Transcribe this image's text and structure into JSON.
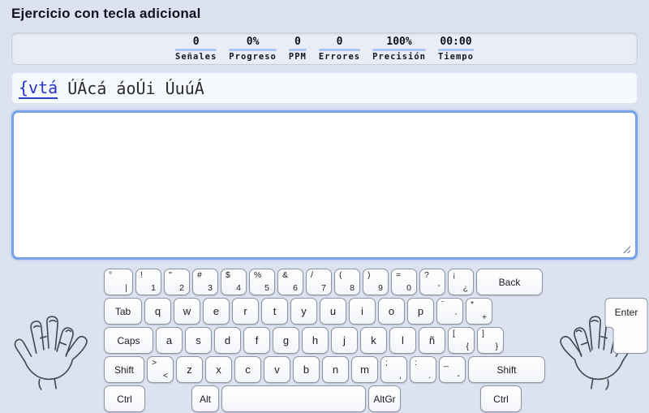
{
  "title": "Ejercicio con tecla adicional",
  "stats": {
    "items": [
      {
        "value": "0",
        "label": "Señales"
      },
      {
        "value": "0%",
        "label": "Progreso"
      },
      {
        "value": "0",
        "label": "PPM"
      },
      {
        "value": "0",
        "label": "Errores"
      },
      {
        "value": "100%",
        "label": "Precisión"
      },
      {
        "value": "00:00",
        "label": "Tiempo"
      }
    ]
  },
  "exercise": {
    "highlight": "{vtá",
    "remaining": " ÚÁcá áoÚi ÚuúÁ"
  },
  "typing_area": {
    "value": "",
    "placeholder": ""
  },
  "keyboard": {
    "enter_label": "Enter",
    "rows": [
      {
        "keys": [
          {
            "shift": "°",
            "main": "|",
            "w": 36
          },
          {
            "shift": "!",
            "main": "1",
            "w": 32
          },
          {
            "shift": "\"",
            "main": "2",
            "w": 32
          },
          {
            "shift": "#",
            "main": "3",
            "w": 32
          },
          {
            "shift": "$",
            "main": "4",
            "w": 32
          },
          {
            "shift": "%",
            "main": "5",
            "w": 32
          },
          {
            "shift": "&",
            "main": "6",
            "w": 32
          },
          {
            "shift": "/",
            "main": "7",
            "w": 32
          },
          {
            "shift": "(",
            "main": "8",
            "w": 32
          },
          {
            "shift": ")",
            "main": "9",
            "w": 32
          },
          {
            "shift": "=",
            "main": "0",
            "w": 32
          },
          {
            "shift": "?",
            "main": "'",
            "w": 32
          },
          {
            "shift": "¡",
            "main": "¿",
            "w": 32
          },
          {
            "label": "Back",
            "w": 82
          }
        ]
      },
      {
        "keys": [
          {
            "label": "Tab",
            "w": 47
          },
          {
            "main": "q",
            "w": 33
          },
          {
            "main": "w",
            "w": 33
          },
          {
            "main": "e",
            "w": 33
          },
          {
            "main": "r",
            "w": 33
          },
          {
            "main": "t",
            "w": 33
          },
          {
            "main": "y",
            "w": 33
          },
          {
            "main": "u",
            "w": 33
          },
          {
            "main": "i",
            "w": 33
          },
          {
            "main": "o",
            "w": 33
          },
          {
            "main": "p",
            "w": 33
          },
          {
            "shift": "¨",
            "main": "´",
            "w": 33
          },
          {
            "shift": "*",
            "main": "+",
            "w": 33
          }
        ]
      },
      {
        "keys": [
          {
            "label": "Caps",
            "w": 61
          },
          {
            "main": "a",
            "w": 33
          },
          {
            "main": "s",
            "w": 33
          },
          {
            "main": "d",
            "w": 33
          },
          {
            "main": "f",
            "w": 33
          },
          {
            "main": "g",
            "w": 33
          },
          {
            "main": "h",
            "w": 33
          },
          {
            "main": "j",
            "w": 33
          },
          {
            "main": "k",
            "w": 33
          },
          {
            "main": "l",
            "w": 33
          },
          {
            "main": "ñ",
            "w": 33
          },
          {
            "shift": "[",
            "main": "{",
            "w": 33
          },
          {
            "shift": "]",
            "main": "}",
            "w": 33
          }
        ]
      },
      {
        "keys": [
          {
            "label": "Shift",
            "w": 50
          },
          {
            "shift": ">",
            "main": "<",
            "w": 33
          },
          {
            "main": "z",
            "w": 33
          },
          {
            "main": "x",
            "w": 33
          },
          {
            "main": "c",
            "w": 33
          },
          {
            "main": "v",
            "w": 33
          },
          {
            "main": "b",
            "w": 33
          },
          {
            "main": "n",
            "w": 33
          },
          {
            "main": "m",
            "w": 33
          },
          {
            "shift": ";",
            "main": ",",
            "w": 33
          },
          {
            "shift": ":",
            "main": ".",
            "w": 33
          },
          {
            "shift": "_",
            "main": "-",
            "w": 33
          },
          {
            "label": "Shift",
            "w": 95
          }
        ]
      },
      {
        "keys": [
          {
            "label": "Ctrl",
            "w": 51
          },
          {
            "spacer": true,
            "w": 51
          },
          {
            "label": "Alt",
            "w": 34
          },
          {
            "label": "",
            "name": "space",
            "w": 178
          },
          {
            "label": "AltGr",
            "w": 40
          },
          {
            "spacer": true,
            "w": 92
          },
          {
            "label": "Ctrl",
            "w": 51
          }
        ]
      }
    ]
  },
  "colors": {
    "page_bg": "#dce2ef",
    "panel_bg": "#e9edf6",
    "field_bg": "#f6f9fd",
    "stat_underline": "#a9c7f0",
    "highlight_blue": "#2335cc",
    "textarea_border": "#7aa2e8",
    "key_border": "#8d93a0"
  },
  "icons": {
    "left_hand": "left-hand-sketch",
    "right_hand": "right-hand-sketch",
    "resize_grip": "resize-grip"
  }
}
